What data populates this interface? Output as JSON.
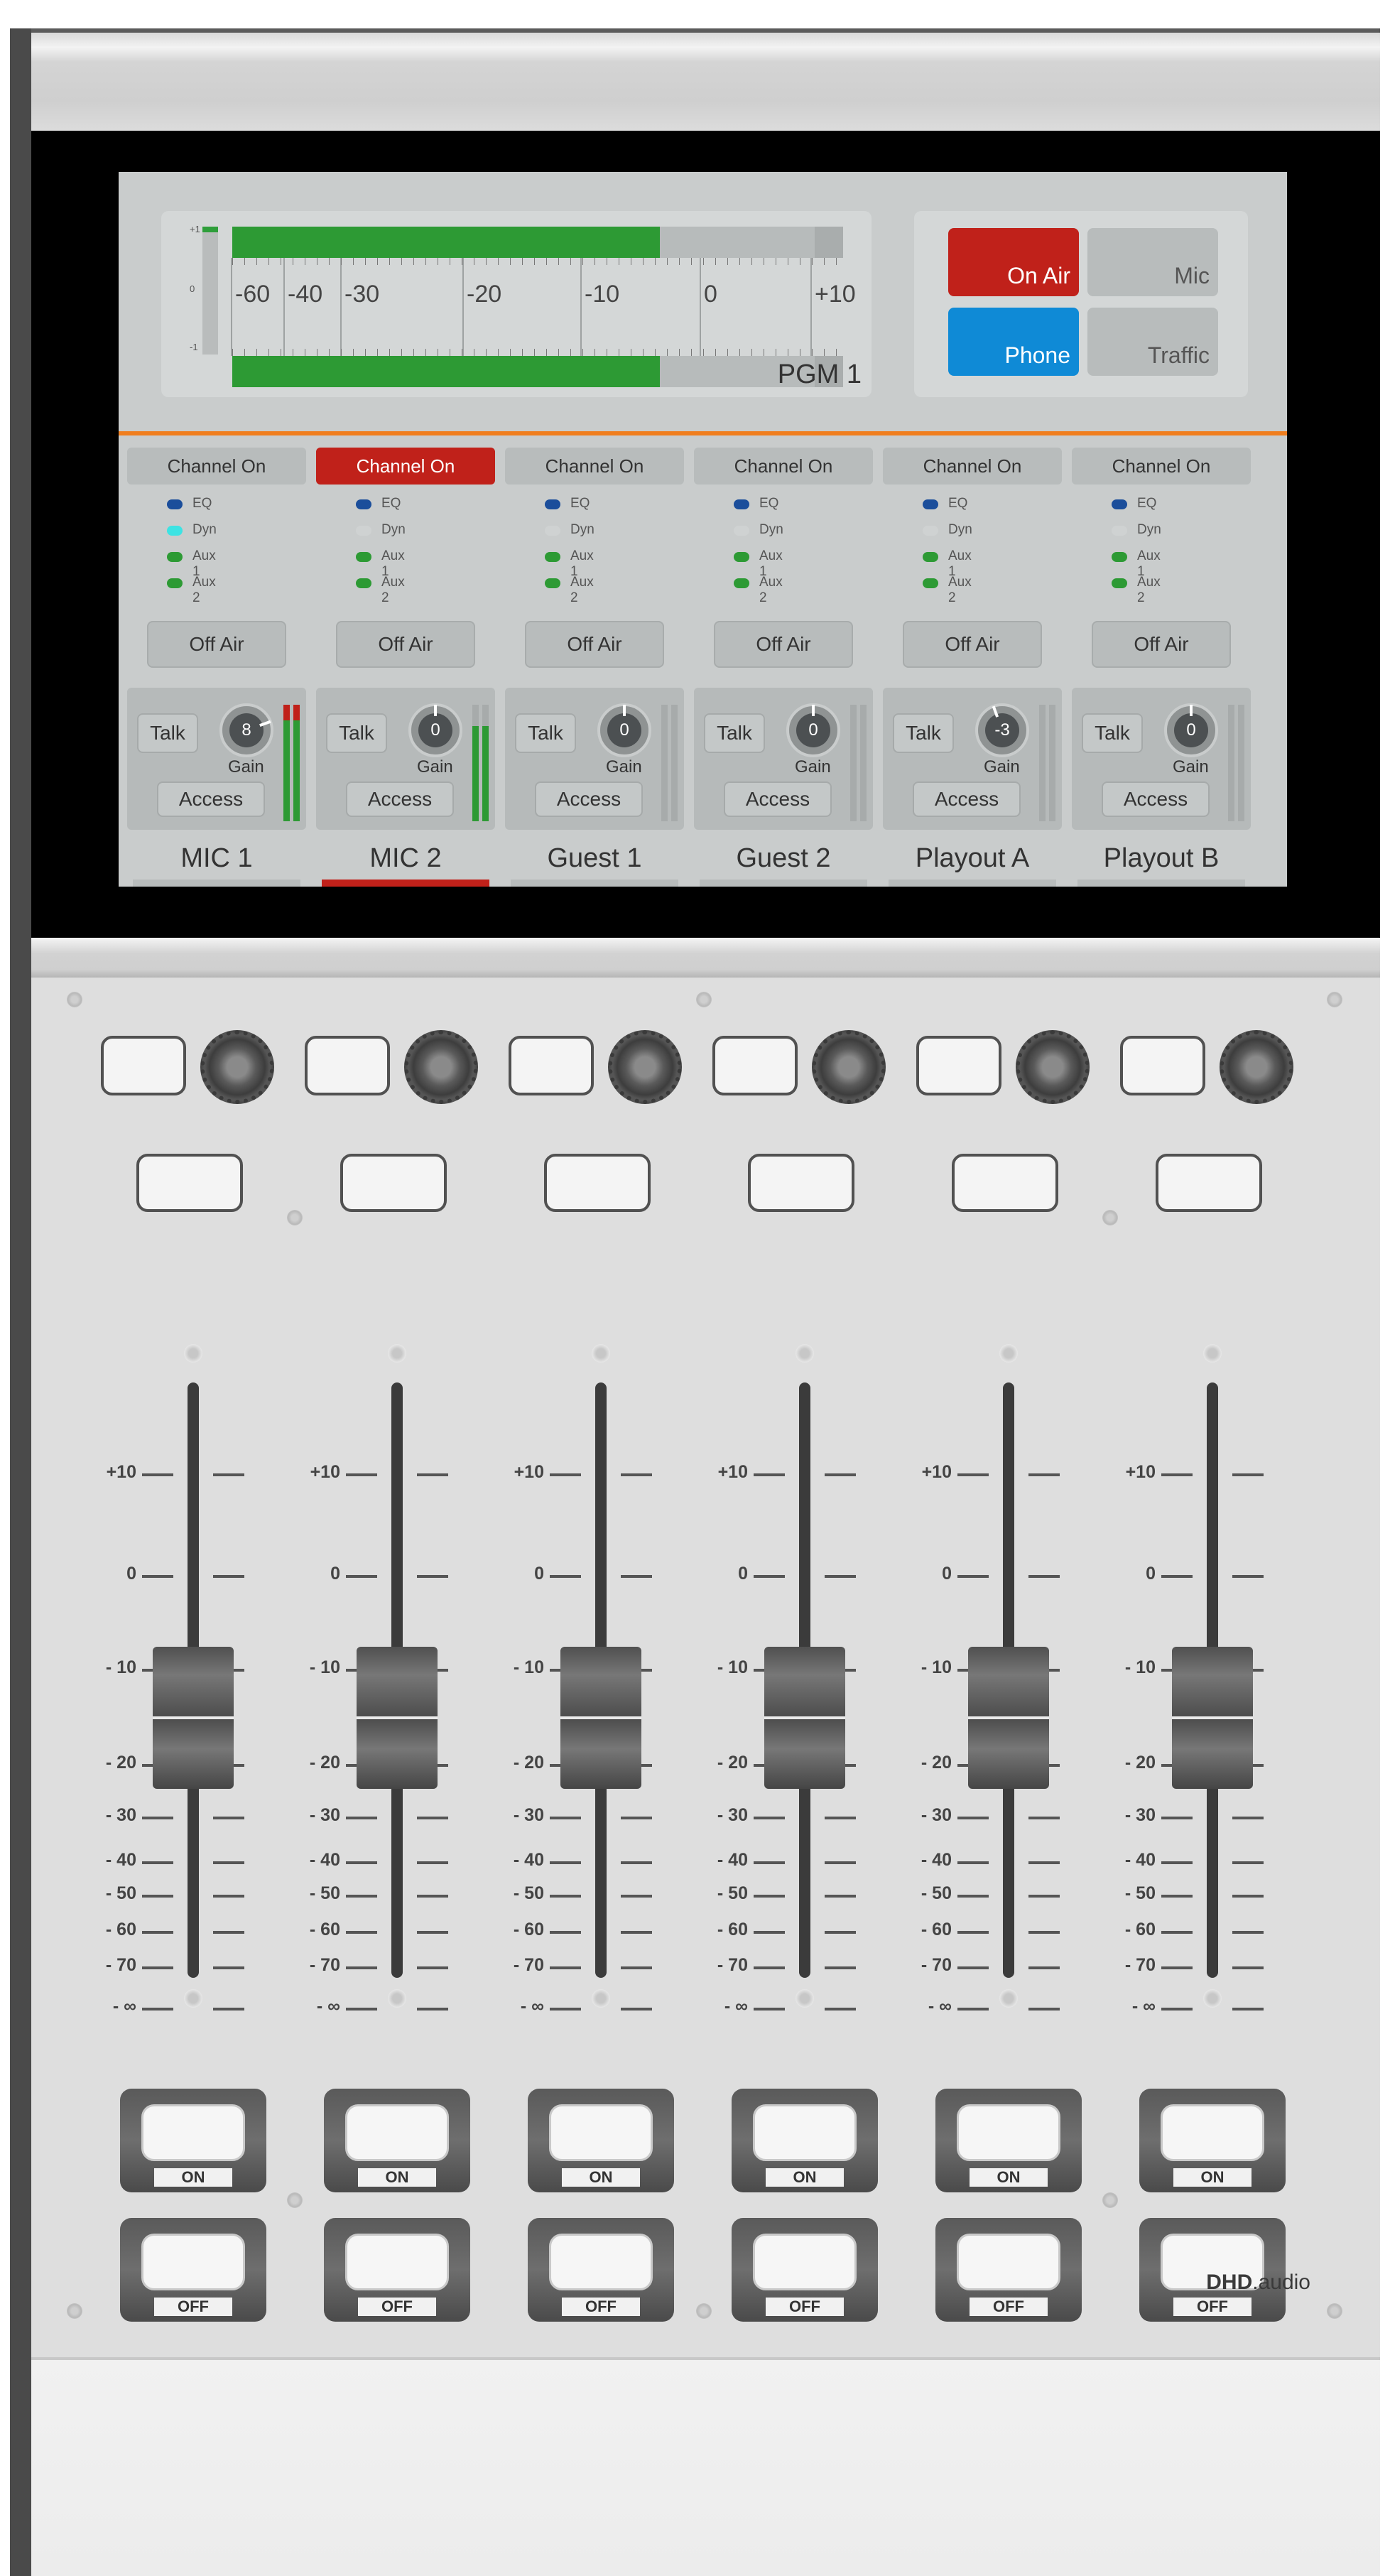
{
  "meter": {
    "mini_top": "+1",
    "mini_mid": "0",
    "mini_bot": "-1",
    "scale_labels": [
      "-60",
      "-40",
      "-30",
      "-20",
      "-10",
      "0",
      "+10"
    ],
    "level_fraction": 0.7,
    "source_label": "PGM 1"
  },
  "status": {
    "on_air": "On Air",
    "mic": "Mic",
    "phone": "Phone",
    "traffic": "Traffic",
    "colors": {
      "on_air": "#c0211a",
      "phone": "#0f8ad6",
      "inactive": "#b8bcbc"
    }
  },
  "accent": "#f07e1e",
  "channels": [
    {
      "on_label": "Channel On",
      "active": false,
      "opts": [
        "EQ",
        "Dyn",
        "Aux 1",
        "Aux 2"
      ],
      "leds": [
        "#1b4e9b",
        "#3de3e3",
        "#2d9a34",
        "#2d9a34"
      ],
      "off_label": "Off Air",
      "talk": "Talk",
      "gain_value": "8",
      "gain_label": "Gain",
      "access": "Access",
      "meter_level": 0.92,
      "peak": true,
      "name": "MIC 1"
    },
    {
      "on_label": "Channel On",
      "active": true,
      "opts": [
        "EQ",
        "Dyn",
        "Aux 1",
        "Aux 2"
      ],
      "leds": [
        "#1b4e9b",
        "#cfd2d2",
        "#2d9a34",
        "#2d9a34"
      ],
      "off_label": "Off Air",
      "talk": "Talk",
      "gain_value": "0",
      "gain_label": "Gain",
      "access": "Access",
      "meter_level": 0.82,
      "peak": false,
      "name": "MIC 2"
    },
    {
      "on_label": "Channel On",
      "active": false,
      "opts": [
        "EQ",
        "Dyn",
        "Aux 1",
        "Aux 2"
      ],
      "leds": [
        "#1b4e9b",
        "#cfd2d2",
        "#2d9a34",
        "#2d9a34"
      ],
      "off_label": "Off Air",
      "talk": "Talk",
      "gain_value": "0",
      "gain_label": "Gain",
      "access": "Access",
      "meter_level": 0,
      "peak": false,
      "name": "Guest 1"
    },
    {
      "on_label": "Channel On",
      "active": false,
      "opts": [
        "EQ",
        "Dyn",
        "Aux 1",
        "Aux 2"
      ],
      "leds": [
        "#1b4e9b",
        "#cfd2d2",
        "#2d9a34",
        "#2d9a34"
      ],
      "off_label": "Off Air",
      "talk": "Talk",
      "gain_value": "0",
      "gain_label": "Gain",
      "access": "Access",
      "meter_level": 0,
      "peak": false,
      "name": "Guest 2"
    },
    {
      "on_label": "Channel On",
      "active": false,
      "opts": [
        "EQ",
        "Dyn",
        "Aux 1",
        "Aux 2"
      ],
      "leds": [
        "#1b4e9b",
        "#cfd2d2",
        "#2d9a34",
        "#2d9a34"
      ],
      "off_label": "Off Air",
      "talk": "Talk",
      "gain_value": "-3",
      "gain_label": "Gain",
      "access": "Access",
      "meter_level": 0,
      "peak": false,
      "name": "Playout A"
    },
    {
      "on_label": "Channel On",
      "active": false,
      "opts": [
        "EQ",
        "Dyn",
        "Aux 1",
        "Aux 2"
      ],
      "leds": [
        "#1b4e9b",
        "#cfd2d2",
        "#2d9a34",
        "#2d9a34"
      ],
      "off_label": "Off Air",
      "talk": "Talk",
      "gain_value": "0",
      "gain_label": "Gain",
      "access": "Access",
      "meter_level": 0,
      "peak": false,
      "name": "Playout B"
    }
  ],
  "fader_scale": [
    "+10",
    "0",
    "- 10",
    "- 20",
    "- 30",
    "- 40",
    "- 50",
    "- 60",
    "- 70",
    "- ∞"
  ],
  "fader_level": "-25",
  "hw_buttons": {
    "on": "ON",
    "off": "OFF"
  },
  "brand": {
    "bold": "DHD",
    "rest": ".audio"
  }
}
